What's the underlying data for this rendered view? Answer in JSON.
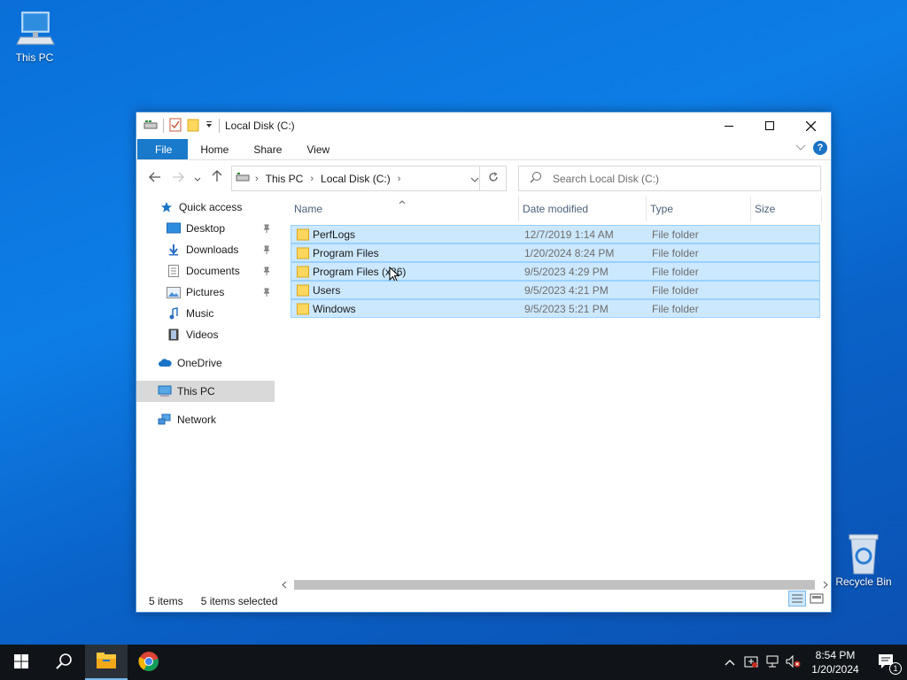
{
  "desktop": {
    "this_pc_label": "This PC",
    "recycle_bin_label": "Recycle Bin"
  },
  "window": {
    "title": "Local Disk (C:)",
    "ribbon_tabs": [
      "File",
      "Home",
      "Share",
      "View"
    ],
    "address": {
      "crumbs": [
        "This PC",
        "Local Disk (C:)"
      ]
    },
    "search_placeholder": "Search Local Disk (C:)",
    "nav": {
      "quick_access": "Quick access",
      "quick_items": [
        "Desktop",
        "Downloads",
        "Documents",
        "Pictures",
        "Music",
        "Videos"
      ],
      "onedrive": "OneDrive",
      "this_pc": "This PC",
      "network": "Network"
    },
    "columns": [
      "Name",
      "Date modified",
      "Type",
      "Size"
    ],
    "files": [
      {
        "name": "PerfLogs",
        "date": "12/7/2019 1:14 AM",
        "type": "File folder",
        "size": ""
      },
      {
        "name": "Program Files",
        "date": "1/20/2024 8:24 PM",
        "type": "File folder",
        "size": ""
      },
      {
        "name": "Program Files (x86)",
        "date": "9/5/2023 4:29 PM",
        "type": "File folder",
        "size": ""
      },
      {
        "name": "Users",
        "date": "9/5/2023 4:21 PM",
        "type": "File folder",
        "size": ""
      },
      {
        "name": "Windows",
        "date": "9/5/2023 5:21 PM",
        "type": "File folder",
        "size": ""
      }
    ],
    "status": {
      "items": "5 items",
      "selected": "5 items selected"
    }
  },
  "taskbar": {
    "time": "8:54 PM",
    "date": "1/20/2024",
    "notification_count": "1"
  },
  "colors": {
    "accent": "#1979ca",
    "selection": "#cce8ff",
    "selection_border": "#99d1ff",
    "taskbar": "#101418"
  }
}
